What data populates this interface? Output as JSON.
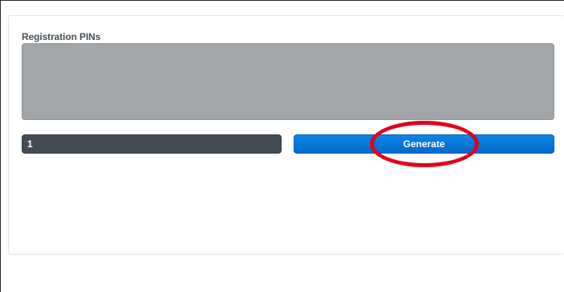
{
  "panel": {
    "label": "Registration PINs",
    "pins_text": ""
  },
  "controls": {
    "count_value": "1",
    "generate_label": "Generate"
  },
  "annotation": {
    "color": "#e3001b",
    "target": "generate-button"
  },
  "colors": {
    "pins_area_bg": "#a2a6a9",
    "count_input_bg": "#424b54",
    "button_bg": "#0b7ddb"
  }
}
